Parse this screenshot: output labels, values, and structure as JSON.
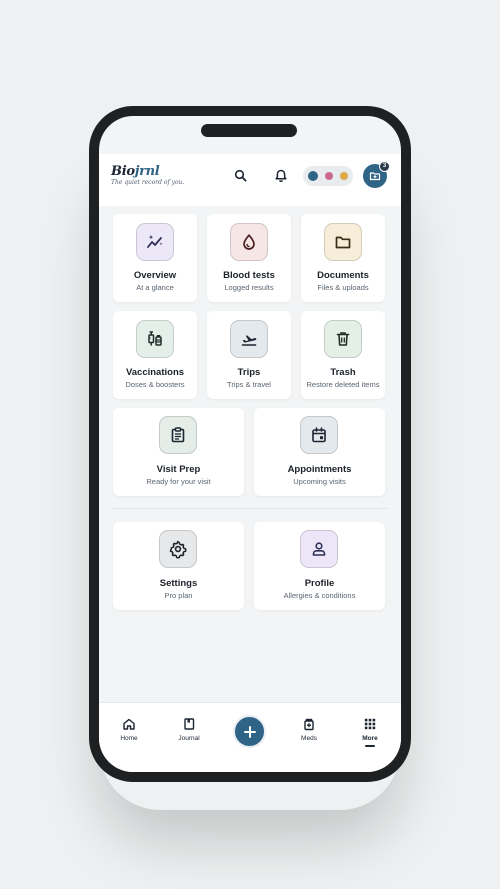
{
  "brand": {
    "name_a": "Bio",
    "name_b": "jrnl",
    "tagline": "The quiet record of you.",
    "accent_color": "#2f6487"
  },
  "header": {
    "search_icon": "search-icon",
    "bell_icon": "bell-icon",
    "profile_dots": [
      "#2f6487",
      "#c96a8a",
      "#e0a84a"
    ],
    "avatar_badge": "3"
  },
  "tiles": [
    {
      "title": "Overview",
      "subtitle": "At a glance",
      "icon": "trend-sparkle-icon",
      "bg": "#ece8f7"
    },
    {
      "title": "Blood tests",
      "subtitle": "Logged results",
      "icon": "blood-drop-icon",
      "bg": "#f6e6e6"
    },
    {
      "title": "Documents",
      "subtitle": "Files & uploads",
      "icon": "folder-icon",
      "bg": "#f7eed9"
    },
    {
      "title": "Vaccinations",
      "subtitle": "Doses & boosters",
      "icon": "syringe-vial-icon",
      "bg": "#e4efea"
    },
    {
      "title": "Trips",
      "subtitle": "Trips & travel",
      "icon": "plane-departure-icon",
      "bg": "#e4e9ee"
    },
    {
      "title": "Trash",
      "subtitle": "Restore deleted items",
      "icon": "trash-icon",
      "bg": "#e4efe6"
    },
    {
      "title": "Visit Prep",
      "subtitle": "Ready for your visit",
      "icon": "clipboard-icon",
      "bg": "#e4ede8"
    },
    {
      "title": "Appointments",
      "subtitle": "Upcoming visits",
      "icon": "calendar-icon",
      "bg": "#e4e9ee"
    },
    {
      "title": "Settings",
      "subtitle": "Pro plan",
      "icon": "gear-icon",
      "bg": "#e6e8ea"
    },
    {
      "title": "Profile",
      "subtitle": "Allergies & conditions",
      "icon": "person-icon",
      "bg": "#ece6f8"
    }
  ],
  "tabbar": {
    "home": "Home",
    "journal": "Journal",
    "add": "+",
    "meds": "Meds",
    "more": "More",
    "active": "More"
  }
}
